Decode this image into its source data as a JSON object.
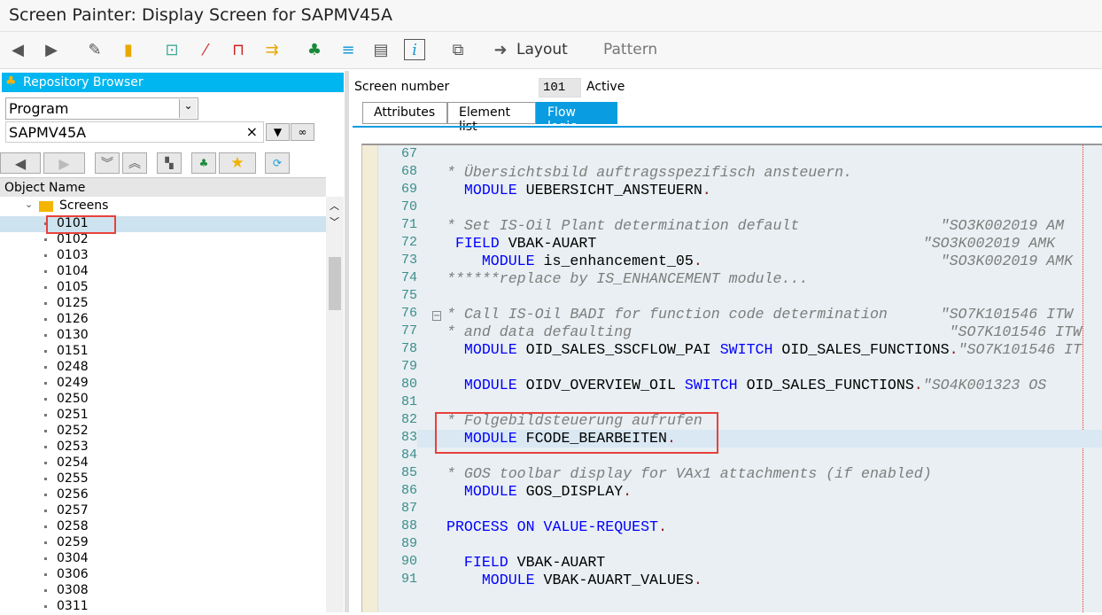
{
  "title": "Screen Painter: Display Screen for SAPMV45A",
  "toolbar": {
    "icons": [
      "back-icon",
      "forward-icon",
      "display-change-icon",
      "active-inactive-icon",
      "other-object-icon",
      "check-icon",
      "activate-icon",
      "where-used-icon",
      "object-list-icon",
      "navigation-window-icon",
      "documentation-icon",
      "info-icon",
      "layout-icon"
    ],
    "layout_label": "Layout",
    "pattern_label": "Pattern"
  },
  "repo": {
    "header": "Repository Browser",
    "object_type": "Program",
    "object_name": "SAPMV45A",
    "column_header": "Object Name",
    "folder": "Screens",
    "screens": [
      "0101",
      "0102",
      "0103",
      "0104",
      "0105",
      "0125",
      "0126",
      "0130",
      "0151",
      "0248",
      "0249",
      "0250",
      "0251",
      "0252",
      "0253",
      "0254",
      "0255",
      "0256",
      "0257",
      "0258",
      "0259",
      "0304",
      "0306",
      "0308",
      "0311"
    ],
    "selected": "0101"
  },
  "screen": {
    "label": "Screen number",
    "number": "101",
    "status": "Active"
  },
  "tabs": [
    "Attributes",
    "Element list",
    "Flow logic"
  ],
  "active_tab": "Flow logic",
  "current_line": 83,
  "code": [
    {
      "n": "67",
      "s": []
    },
    {
      "n": "68",
      "s": [
        {
          "c": "cm",
          "t": "* Übersichtsbild auftragsspezifisch ansteuern."
        }
      ]
    },
    {
      "n": "69",
      "s": [
        {
          "c": "tx",
          "t": "  "
        },
        {
          "c": "kw",
          "t": "MODULE"
        },
        {
          "c": "tx",
          "t": " UEBERSICHT_ANSTEUERN"
        },
        {
          "c": "pt",
          "t": "."
        }
      ]
    },
    {
      "n": "70",
      "s": []
    },
    {
      "n": "71",
      "s": [
        {
          "c": "cm",
          "t": "* Set IS-Oil Plant determination default                \"SO3K002019 AM"
        }
      ]
    },
    {
      "n": "72",
      "s": [
        {
          "c": "tx",
          "t": " "
        },
        {
          "c": "kw",
          "t": "FIELD"
        },
        {
          "c": "tx",
          "t": " VBAK-AUART                                     "
        },
        {
          "c": "cm",
          "t": "\"SO3K002019 AMK"
        }
      ]
    },
    {
      "n": "73",
      "s": [
        {
          "c": "tx",
          "t": "    "
        },
        {
          "c": "kw",
          "t": "MODULE"
        },
        {
          "c": "tx",
          "t": " is_enhancement_05"
        },
        {
          "c": "pt",
          "t": "."
        },
        {
          "c": "tx",
          "t": "                           "
        },
        {
          "c": "cm",
          "t": "\"SO3K002019 AMK"
        }
      ]
    },
    {
      "n": "74",
      "s": [
        {
          "c": "cm",
          "t": "******replace by IS_ENHANCEMENT module..."
        }
      ]
    },
    {
      "n": "75",
      "s": []
    },
    {
      "n": "76",
      "s": [
        {
          "c": "cm",
          "t": "* Call IS-Oil BADI for function code determination      \"SO7K101546 ITW"
        }
      ]
    },
    {
      "n": "77",
      "s": [
        {
          "c": "cm",
          "t": "* and data defaulting                                    \"SO7K101546 ITW"
        }
      ]
    },
    {
      "n": "78",
      "s": [
        {
          "c": "tx",
          "t": "  "
        },
        {
          "c": "kw",
          "t": "MODULE"
        },
        {
          "c": "tx",
          "t": " OID_SALES_SSCFLOW_PAI "
        },
        {
          "c": "kw",
          "t": "SWITCH"
        },
        {
          "c": "tx",
          "t": " OID_SALES_FUNCTIONS"
        },
        {
          "c": "pt",
          "t": "."
        },
        {
          "c": "cm",
          "t": "\"SO7K101546 IT"
        }
      ]
    },
    {
      "n": "79",
      "s": []
    },
    {
      "n": "80",
      "s": [
        {
          "c": "tx",
          "t": "  "
        },
        {
          "c": "kw",
          "t": "MODULE"
        },
        {
          "c": "tx",
          "t": " OIDV_OVERVIEW_OIL "
        },
        {
          "c": "kw",
          "t": "SWITCH"
        },
        {
          "c": "tx",
          "t": " OID_SALES_FUNCTIONS"
        },
        {
          "c": "pt",
          "t": "."
        },
        {
          "c": "cm",
          "t": "\"SO4K001323 OS"
        }
      ]
    },
    {
      "n": "81",
      "s": []
    },
    {
      "n": "82",
      "s": [
        {
          "c": "cm",
          "t": "* Folgebildsteuerung aufrufen"
        }
      ]
    },
    {
      "n": "83",
      "s": [
        {
          "c": "tx",
          "t": "  "
        },
        {
          "c": "kw",
          "t": "MODULE"
        },
        {
          "c": "tx",
          "t": " FCODE_BEARBEITEN"
        },
        {
          "c": "pt",
          "t": "."
        }
      ]
    },
    {
      "n": "84",
      "s": []
    },
    {
      "n": "85",
      "s": [
        {
          "c": "cm",
          "t": "* GOS toolbar display for VAx1 attachments (if enabled)"
        }
      ]
    },
    {
      "n": "86",
      "s": [
        {
          "c": "tx",
          "t": "  "
        },
        {
          "c": "kw",
          "t": "MODULE"
        },
        {
          "c": "tx",
          "t": " GOS_DISPLAY"
        },
        {
          "c": "pt",
          "t": "."
        }
      ]
    },
    {
      "n": "87",
      "s": []
    },
    {
      "n": "88",
      "s": [
        {
          "c": "kw",
          "t": "PROCESS ON VALUE-REQUEST"
        },
        {
          "c": "pt",
          "t": "."
        }
      ]
    },
    {
      "n": "89",
      "s": []
    },
    {
      "n": "90",
      "s": [
        {
          "c": "tx",
          "t": "  "
        },
        {
          "c": "kw",
          "t": "FIELD"
        },
        {
          "c": "tx",
          "t": " VBAK-AUART"
        }
      ]
    },
    {
      "n": "91",
      "s": [
        {
          "c": "tx",
          "t": "    "
        },
        {
          "c": "kw",
          "t": "MODULE"
        },
        {
          "c": "tx",
          "t": " VBAK-AUART_VALUES"
        },
        {
          "c": "pt",
          "t": "."
        }
      ]
    }
  ]
}
